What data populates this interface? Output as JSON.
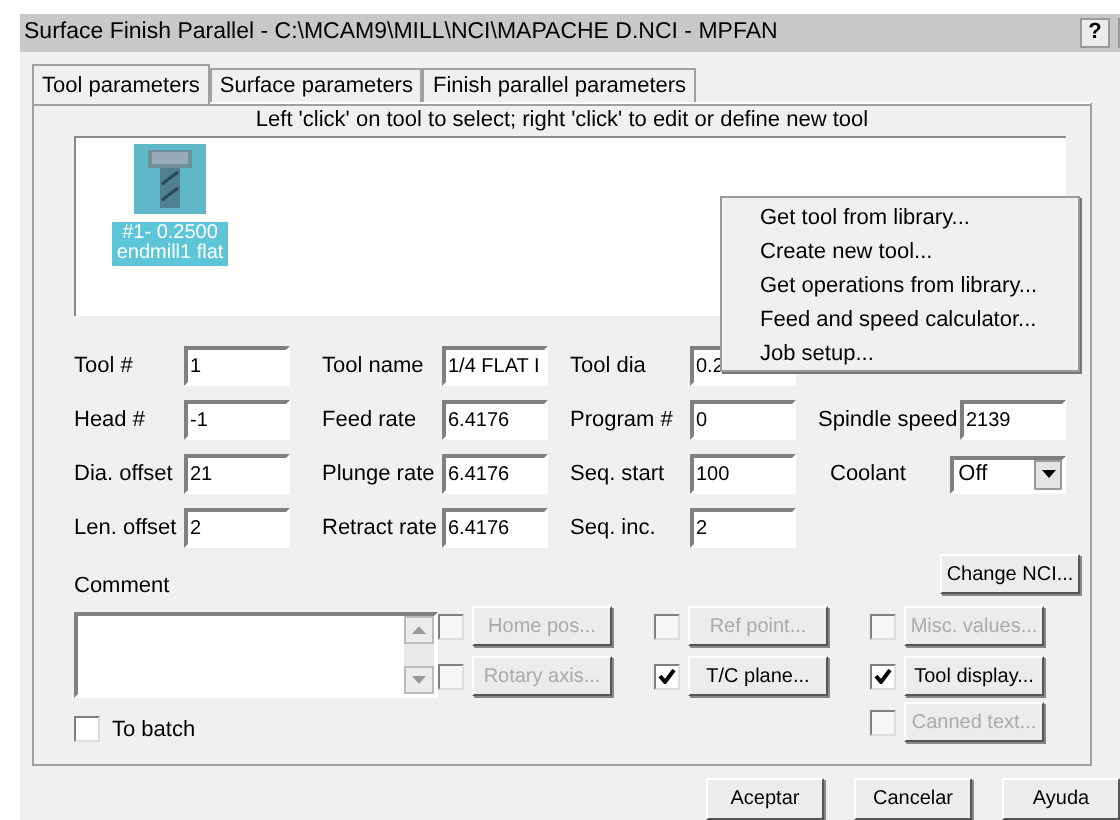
{
  "window": {
    "title": "Surface Finish Parallel - C:\\MCAM9\\MILL\\NCI\\MAPACHE D.NCI - MPFAN",
    "help": "?"
  },
  "tabs": [
    {
      "label": "Tool parameters",
      "selected": true
    },
    {
      "label": "Surface parameters",
      "selected": false
    },
    {
      "label": "Finish parallel parameters",
      "selected": false
    }
  ],
  "hint": "Left 'click' on tool to select; right 'click' to edit or define new tool",
  "tools": [
    {
      "number": "#1- 0.2500",
      "name": "endmill1 flat",
      "selected": true
    }
  ],
  "context_menu": [
    "Get tool from library...",
    "Create new tool...",
    "Get operations from library...",
    "Feed and speed calculator...",
    "Job setup..."
  ],
  "field_rows": [
    [
      {
        "label": "Tool #",
        "value": "1",
        "kind": "text"
      },
      {
        "label": "Tool name",
        "value": "1/4 FLAT I",
        "kind": "text"
      },
      {
        "label": "Tool dia",
        "value": "0.2",
        "kind": "text"
      }
    ],
    [
      {
        "label": "Head #",
        "value": "-1",
        "kind": "text"
      },
      {
        "label": "Feed rate",
        "value": "6.4176",
        "kind": "text"
      },
      {
        "label": "Program #",
        "value": "0",
        "kind": "text"
      },
      {
        "label": "Spindle speed",
        "value": "2139",
        "kind": "text"
      }
    ],
    [
      {
        "label": "Dia. offset",
        "value": "21",
        "kind": "text"
      },
      {
        "label": "Plunge rate",
        "value": "6.4176",
        "kind": "text"
      },
      {
        "label": "Seq. start",
        "value": "100",
        "kind": "text"
      },
      {
        "label": "Coolant",
        "value": "Off",
        "kind": "select"
      }
    ],
    [
      {
        "label": "Len. offset",
        "value": "2",
        "kind": "text"
      },
      {
        "label": "Retract rate",
        "value": "6.4176",
        "kind": "text"
      },
      {
        "label": "Seq. inc.",
        "value": "2",
        "kind": "text"
      }
    ]
  ],
  "comment": {
    "label": "Comment"
  },
  "to_batch": {
    "label": "To batch",
    "checked": false
  },
  "option_rows": [
    [
      null,
      null,
      {
        "kind": "button",
        "label": "Change NCI...",
        "disabled": false
      }
    ],
    [
      {
        "kind": "check",
        "label": "Home pos...",
        "checked": false,
        "disabled": true
      },
      {
        "kind": "check",
        "label": "Ref point...",
        "checked": false,
        "disabled": true
      },
      {
        "kind": "check",
        "label": "Misc. values...",
        "checked": false,
        "disabled": true
      }
    ],
    [
      {
        "kind": "check",
        "label": "Rotary axis...",
        "checked": false,
        "disabled": true
      },
      {
        "kind": "check",
        "label": "T/C plane...",
        "checked": true,
        "disabled": false
      },
      {
        "kind": "check",
        "label": "Tool display...",
        "checked": true,
        "disabled": false
      }
    ],
    [
      null,
      null,
      {
        "kind": "check",
        "label": "Canned text...",
        "checked": false,
        "disabled": true
      }
    ]
  ],
  "buttons": [
    "Aceptar",
    "Cancelar",
    "Ayuda"
  ]
}
